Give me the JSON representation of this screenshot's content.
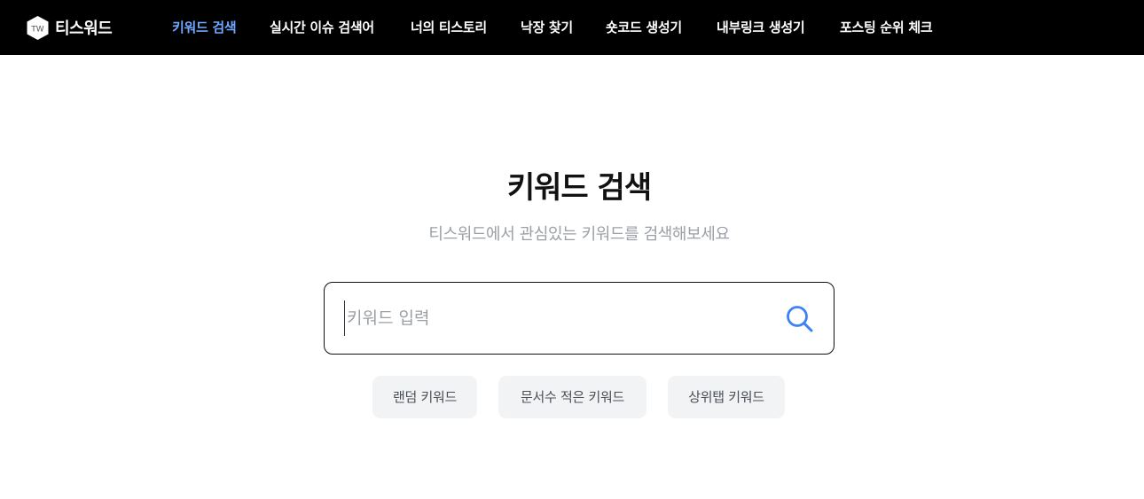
{
  "header": {
    "brand_name": "티스워드",
    "logo_text": "TW",
    "nav": [
      {
        "label": "키워드 검색",
        "active": true
      },
      {
        "label": "실시간 이슈 검색어",
        "active": false
      },
      {
        "label": "너의 티스토리",
        "active": false
      },
      {
        "label": "낙장 찾기",
        "active": false
      },
      {
        "label": "숏코드 생성기",
        "active": false
      },
      {
        "label": "내부링크 생성기",
        "active": false
      },
      {
        "label": "포스팅 순위 체크",
        "active": false
      }
    ]
  },
  "main": {
    "title": "키워드 검색",
    "subtitle": "티스워드에서 관심있는 키워드를 검색해보세요",
    "search": {
      "value": "",
      "placeholder": "키워드 입력",
      "icon": "search-icon"
    },
    "quick_buttons": [
      {
        "label": "랜덤 키워드"
      },
      {
        "label": "문서수 적은 키워드"
      },
      {
        "label": "상위탭 키워드"
      }
    ]
  },
  "colors": {
    "header_bg": "#000000",
    "nav_active": "#6fa8ff",
    "search_icon": "#3b82f6",
    "chip_bg": "#f1f3f5"
  }
}
